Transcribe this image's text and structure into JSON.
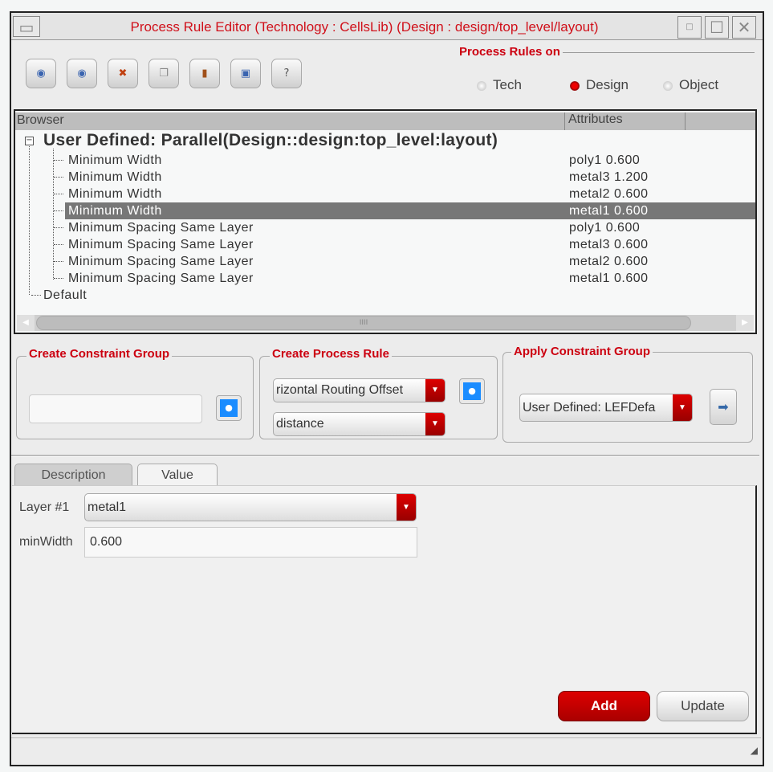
{
  "window": {
    "title": "Process Rule Editor (Technology : CellsLib) (Design : design/top_level/layout)"
  },
  "toolbar": {
    "buttons": [
      {
        "name": "move-up",
        "icon": "up-circle-icon",
        "glyph": "◉"
      },
      {
        "name": "move-down",
        "icon": "down-circle-icon",
        "glyph": "◉"
      },
      {
        "name": "delete",
        "icon": "delete-x-icon",
        "glyph": "✖"
      },
      {
        "name": "copy",
        "icon": "copy-icon",
        "glyph": "❐"
      },
      {
        "name": "paste",
        "icon": "paste-icon",
        "glyph": "▮"
      },
      {
        "name": "save",
        "icon": "save-icon",
        "glyph": "▣"
      },
      {
        "name": "help",
        "icon": "help-icon",
        "glyph": "?"
      }
    ]
  },
  "process_rules_on": {
    "label": "Process Rules on",
    "options": [
      "Tech",
      "Design",
      "Object"
    ],
    "selected": "Design"
  },
  "browser": {
    "columns": [
      "Browser",
      "Attributes"
    ],
    "root": "User Defined: Parallel(Design::design:top_level:layout)",
    "rows": [
      {
        "name": "Minimum Width",
        "attr": "poly1 0.600"
      },
      {
        "name": "Minimum Width",
        "attr": "metal3 1.200"
      },
      {
        "name": "Minimum Width",
        "attr": "metal2 0.600"
      },
      {
        "name": "Minimum Width",
        "attr": "metal1 0.600",
        "selected": true
      },
      {
        "name": "Minimum Spacing Same Layer",
        "attr": "poly1 0.600"
      },
      {
        "name": "Minimum Spacing Same Layer",
        "attr": "metal3 0.600"
      },
      {
        "name": "Minimum Spacing Same Layer",
        "attr": "metal2 0.600"
      },
      {
        "name": "Minimum Spacing Same Layer",
        "attr": "metal1 0.600"
      }
    ],
    "default": "Default",
    "scroll_grip": "IIII"
  },
  "create_group": {
    "label": "Create Constraint Group",
    "value": ""
  },
  "create_rule": {
    "label": "Create Process Rule",
    "rule": "rizontal Routing Offset",
    "param": "distance"
  },
  "apply_group": {
    "label": "Apply Constraint Group",
    "value": "User Defined: LEFDefa"
  },
  "tabs": [
    "Description",
    "Value"
  ],
  "value_panel": {
    "layer_label": "Layer #1",
    "layer_value": "metal1",
    "minwidth_label": "minWidth",
    "minwidth_value": "0.600"
  },
  "buttons": {
    "add": "Add",
    "update": "Update"
  },
  "colors": {
    "accent": "#cc0010",
    "selection": "#777777"
  }
}
